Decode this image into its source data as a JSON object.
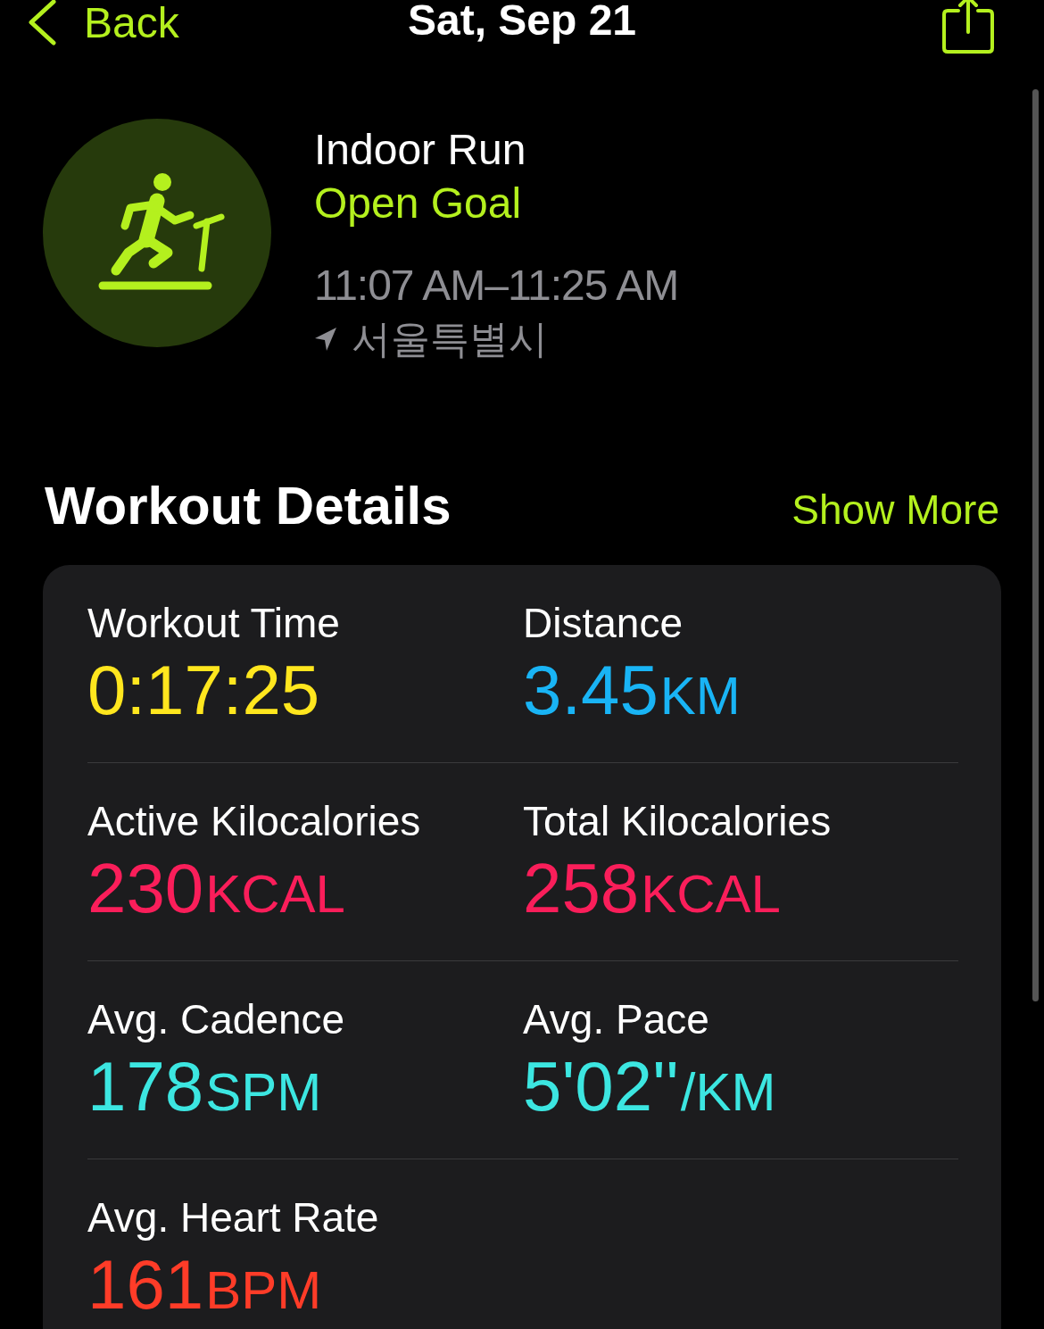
{
  "nav": {
    "back": "Back",
    "title": "Sat, Sep 21"
  },
  "workout": {
    "name": "Indoor Run",
    "goal": "Open Goal",
    "time_range": "11:07 AM–11:25 AM",
    "location": "서울특별시"
  },
  "section": {
    "title": "Workout Details",
    "action": "Show More"
  },
  "metrics": [
    {
      "label": "Workout Time",
      "value": "0:17:25",
      "color": "#ffe61e"
    },
    {
      "label": "Distance",
      "value": "3.45",
      "unit": "KM",
      "color": "#19b4f5"
    },
    {
      "label": "Active Kilocalories",
      "value": "230",
      "unit": "KCAL",
      "color": "#fa1e5a"
    },
    {
      "label": "Total Kilocalories",
      "value": "258",
      "unit": "KCAL",
      "color": "#fa1e5a"
    },
    {
      "label": "Avg. Cadence",
      "value": "178",
      "unit": "SPM",
      "color": "#3ce6e1"
    },
    {
      "label": "Avg. Pace",
      "value": "5'02''",
      "unit": "/KM",
      "color": "#3ce6e1"
    },
    {
      "label": "Avg. Heart Rate",
      "value": "161",
      "unit": "BPM",
      "color": "#ff3c28"
    }
  ]
}
